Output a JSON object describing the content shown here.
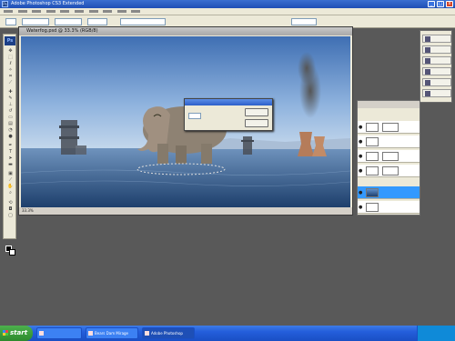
{
  "window": {
    "title": "Adobe Photoshop CS3 Extended",
    "app_icon": "Ps"
  },
  "window_controls": {
    "minimize": "_",
    "maximize": "□",
    "close": "x"
  },
  "menu": {
    "items": [
      "",
      "",
      "",
      "",
      "",
      "",
      "",
      "",
      "",
      ""
    ]
  },
  "toolbox": {
    "logo": "Ps"
  },
  "document": {
    "title": "Waterfog.psd @ 33.3% (RGB/8)",
    "zoom": "33.3%",
    "status": ""
  },
  "dialog": {
    "title": "",
    "field_label": "",
    "field_value": "",
    "ok_label": "",
    "cancel_label": ""
  },
  "layers_panel": {
    "tabs": "",
    "layers": [
      {
        "name": ""
      },
      {
        "name": ""
      },
      {
        "name": ""
      },
      {
        "name": ""
      },
      {
        "name": ""
      },
      {
        "name": ""
      }
    ]
  },
  "side_panel": {
    "items": [
      {
        "label": ""
      },
      {
        "label": ""
      },
      {
        "label": ""
      },
      {
        "label": ""
      },
      {
        "label": ""
      },
      {
        "label": ""
      }
    ]
  },
  "taskbar": {
    "start_label": "start",
    "tasks": [
      {
        "label": ""
      },
      {
        "label": "Bears Dam Mirage"
      },
      {
        "label": "Adobe Photoshop"
      }
    ],
    "clock": ""
  },
  "colors": {
    "accent": "#245edb",
    "canvas_sky": "#5f8fc8",
    "selected_layer": "#3399ff"
  }
}
